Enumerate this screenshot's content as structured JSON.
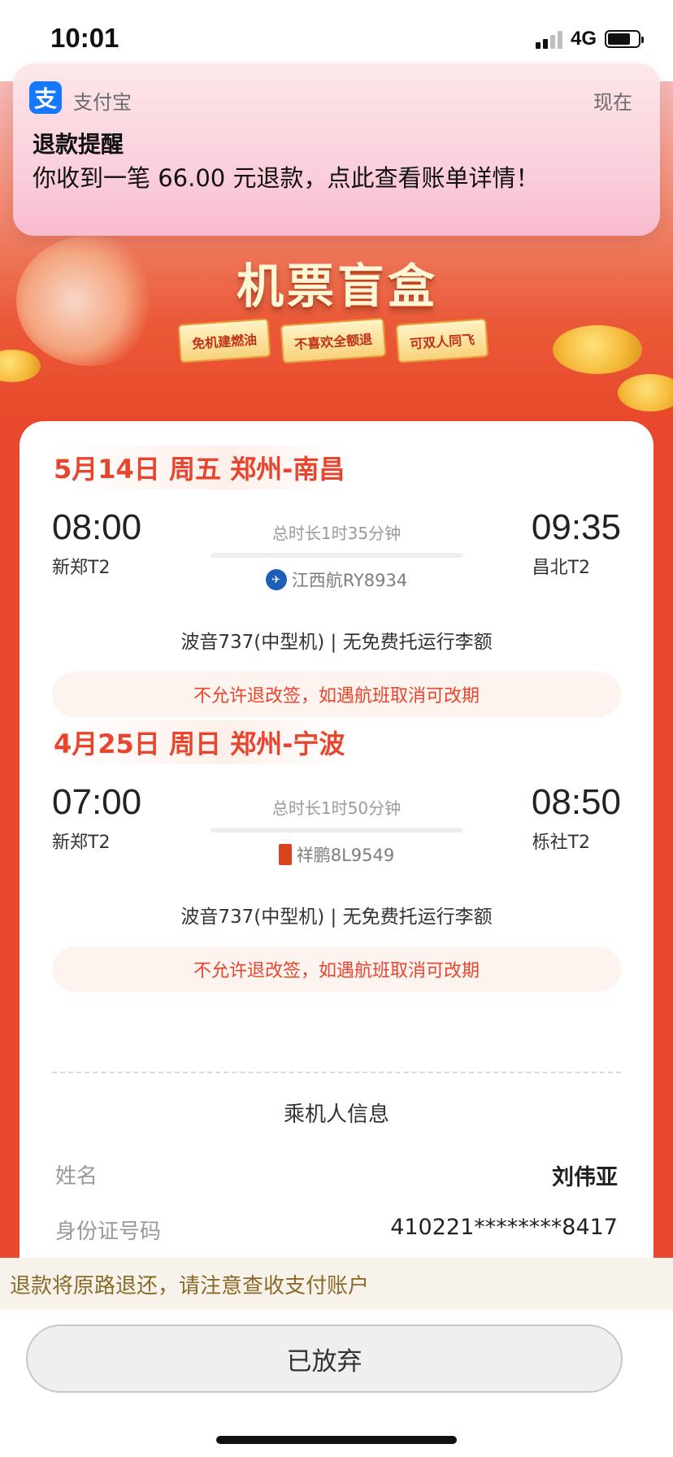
{
  "status_bar": {
    "time": "10:01",
    "network": "4G"
  },
  "notification": {
    "app_name": "支付宝",
    "app_icon": "支",
    "time": "现在",
    "title": "退款提醒",
    "body": "你收到一笔 66.00 元退款，点此查看账单详情！"
  },
  "banner": {
    "title": "机票盲盒",
    "tags": [
      "免机建燃油",
      "不喜欢全额退",
      "可双人同飞"
    ]
  },
  "flights": [
    {
      "date_route": "5月14日 周五 郑州-南昌",
      "dep_time": "08:00",
      "dep_airport": "新郑T2",
      "arr_time": "09:35",
      "arr_airport": "昌北T2",
      "duration": "总时长1时35分钟",
      "airline": "江西航RY8934",
      "airline_icon": "jiangxi-air-logo",
      "aircraft": "波音737(中型机) | 无免费托运行李额",
      "policy": "不允许退改签，如遇航班取消可改期"
    },
    {
      "date_route": "4月25日 周日 郑州-宁波",
      "dep_time": "07:00",
      "dep_airport": "新郑T2",
      "arr_time": "08:50",
      "arr_airport": "栎社T2",
      "duration": "总时长1时50分钟",
      "airline": "祥鹏8L9549",
      "airline_icon": "lucky-air-logo",
      "aircraft": "波音737(中型机) | 无免费托运行李额",
      "policy": "不允许退改签，如遇航班取消可改期"
    }
  ],
  "passenger": {
    "section_title": "乘机人信息",
    "name_label": "姓名",
    "name_value": "刘伟亚",
    "id_label": "身份证号码",
    "id_value": "410221********8417"
  },
  "footer": {
    "refund_note": "退款将原路退还，请注意查收支付账户",
    "button_label": "已放弃"
  },
  "colors": {
    "accent_red": "#e8452e",
    "alipay_blue": "#1677ff",
    "note_text": "#8a6a2a"
  }
}
